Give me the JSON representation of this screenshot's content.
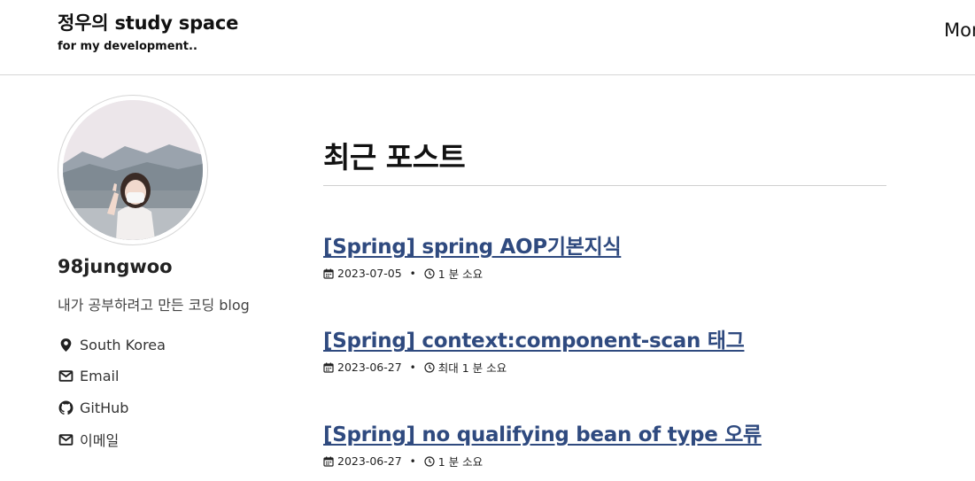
{
  "site": {
    "title": "정우의 study space",
    "subtitle": "for my development..",
    "nav_more": "Mor"
  },
  "author": {
    "avatar_icon": "profile-photo",
    "name": "98jungwoo",
    "bio": "내가 공부하려고 만든 코딩 blog",
    "links": [
      {
        "icon": "location-pin-icon",
        "label": "South Korea"
      },
      {
        "icon": "envelope-icon",
        "label": "Email"
      },
      {
        "icon": "github-icon",
        "label": "GitHub"
      },
      {
        "icon": "envelope-icon",
        "label": "이메일"
      }
    ]
  },
  "main": {
    "heading": "최근 포스트",
    "posts": [
      {
        "title": "[Spring] spring AOP기본지식",
        "date": "2023-07-05",
        "read_time": "1 분 소요"
      },
      {
        "title": "[Spring] context:component-scan 태그",
        "date": "2023-06-27",
        "read_time": "최대 1 분 소요"
      },
      {
        "title": "[Spring] no qualifying bean of type 오류",
        "date": "2023-06-27",
        "read_time": "1 분 소요"
      }
    ],
    "meta_separator": "•"
  },
  "colors": {
    "link": "#2f4a7f",
    "rule": "#d6d6d6",
    "text": "#111111"
  }
}
